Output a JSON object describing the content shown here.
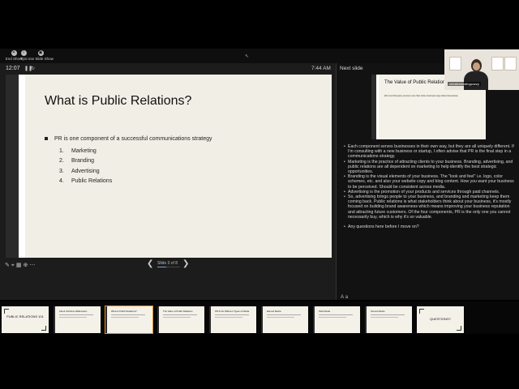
{
  "toolbar": {
    "buttons": [
      {
        "label": "End Show",
        "icon": "end-show-icon"
      },
      {
        "label": "Tips",
        "icon": "info-icon"
      },
      {
        "label": "Use Slide Show",
        "icon": "slideshow-icon"
      }
    ]
  },
  "presenter": {
    "timer": "12:07",
    "clock": "7:44 AM",
    "next_label": "Next slide",
    "slide_counter": "Slide 3 of 8",
    "progress": 0.375
  },
  "current_slide": {
    "title": "What is Public Relations?",
    "bullet": "PR is one component of a successful communications strategy",
    "sub_items": [
      {
        "num": "1.",
        "text": "Marketing"
      },
      {
        "num": "2.",
        "text": "Branding"
      },
      {
        "num": "3.",
        "text": "Advertising"
      },
      {
        "num": "4.",
        "text": "Public Relations"
      }
    ]
  },
  "next_slide": {
    "title": "The Value of Public Relations",
    "body": "We trust third-party sources more than what a business says about themselves."
  },
  "video": {
    "name": "christinetostingcuzzy"
  },
  "notes": [
    "Each component serves businesses in their own way, but they are all uniquely different. If I'm consulting with a new business or startup, I often advise that PR is the final step in a communications strategy.",
    "Marketing is the practice of attracting clients to your business. Branding, advertising, and public relations are all dependent on marketing to help identify the best strategic opportunities.",
    "Branding is the visual elements of your business. The \"look and feel\" i.e. logo, color schemes, etc. and also your website copy and blog content. How you want your business to be perceived. Should be consistent across media.",
    "Advertising is the promotion of your products and services through paid channels.",
    "So, advertising brings people to your business, and branding and marketing keep them coming back. Public relations is what stakeholders think about your business, it's mostly focused on building brand awareness which means improving your business reputation and attracting future customers. Of the four components, PR is the only one you cannot necessarily buy, which is why it's so valuable.",
    "Any questions here before I move on?"
  ],
  "thumbnails": [
    {
      "title": "PUBLIC RELATIONS 101",
      "style": "title"
    },
    {
      "title": "About Christine Wallenstein",
      "style": "content"
    },
    {
      "title": "What is Public Relations?",
      "style": "content"
    },
    {
      "title": "The Value of Public Relations",
      "style": "content"
    },
    {
      "title": "PR & the Different Types of Media",
      "style": "content"
    },
    {
      "title": "Earned Media",
      "style": "content"
    },
    {
      "title": "Paid Media",
      "style": "content"
    },
    {
      "title": "Owned Media",
      "style": "content"
    },
    {
      "title": "QUESTIONS?",
      "style": "title"
    }
  ],
  "colors": {
    "accent": "#e0902a",
    "slide_bg": "#f1eee6",
    "app_bg": "#1c1c1c"
  }
}
